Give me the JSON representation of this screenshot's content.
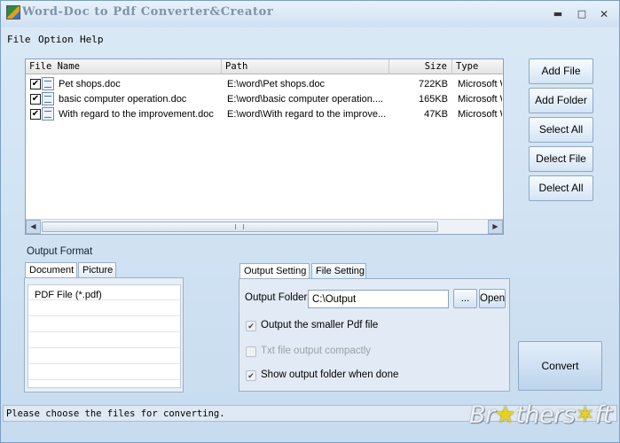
{
  "window": {
    "title": "Word-Doc to Pdf Converter&Creator",
    "minimize_glyph": "▬",
    "maximize_glyph": "□",
    "close_glyph": "✕"
  },
  "menu": {
    "file": "File",
    "option": "Option",
    "help": "Help"
  },
  "file_list": {
    "columns": {
      "name": "File Name",
      "path": "Path",
      "size": "Size",
      "type": "Type"
    },
    "rows": [
      {
        "checked": "✔",
        "name": "Pet shops.doc",
        "path": "E:\\word\\Pet shops.doc",
        "size": "722KB",
        "type": "Microsoft W"
      },
      {
        "checked": "✔",
        "name": "basic computer operation.doc",
        "path": "E:\\word\\basic computer operation....",
        "size": "165KB",
        "type": "Microsoft W"
      },
      {
        "checked": "✔",
        "name": "With regard to the improvement.doc",
        "path": "E:\\word\\With regard to the improve...",
        "size": "47KB",
        "type": "Microsoft W"
      }
    ],
    "scroll_left_glyph": "◀",
    "scroll_right_glyph": "▶"
  },
  "side_buttons": {
    "add_file": "Add File",
    "add_folder": "Add Folder",
    "select_all": "Select All",
    "delect_file": "Delect File",
    "delect_all": "Delect All"
  },
  "output_format": {
    "label": "Output Format",
    "tabs": {
      "document": "Document",
      "picture": "Picture"
    },
    "items": [
      "PDF File  (*.pdf)"
    ]
  },
  "settings": {
    "tabs": {
      "output": "Output Setting",
      "file": "File Setting"
    },
    "output_folder_label": "Output Folder",
    "output_folder_value": "C:\\Output",
    "browse_label": "...",
    "open_label": "Open",
    "options": {
      "smaller_pdf": {
        "label": "Output the smaller Pdf file",
        "mark": "✔"
      },
      "txt_compact": {
        "label": "Txt file output compactly",
        "mark": ""
      },
      "show_folder": {
        "label": "Show output folder when done",
        "mark": "✔"
      }
    }
  },
  "convert_label": "Convert",
  "status_text": "Please choose the files for converting.",
  "watermark": {
    "pre": "Br",
    "star": "★",
    "post": "thers",
    "post2": "ft"
  }
}
